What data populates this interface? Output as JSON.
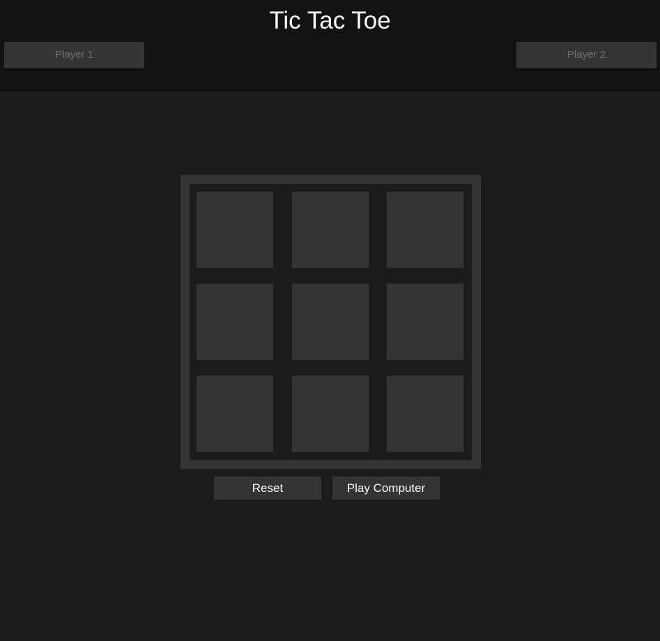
{
  "header": {
    "title": "Tic Tac Toe",
    "player1_label": "Player 1",
    "player2_label": "Player 2"
  },
  "board": {
    "cells": [
      "",
      "",
      "",
      "",
      "",
      "",
      "",
      "",
      ""
    ]
  },
  "controls": {
    "reset_label": "Reset",
    "play_computer_label": "Play Computer"
  },
  "colors": {
    "background": "#1b1b1b",
    "header_background": "#121212",
    "cell": "#343434",
    "text": "#ffffff",
    "player_text": "#6e6e6e"
  }
}
